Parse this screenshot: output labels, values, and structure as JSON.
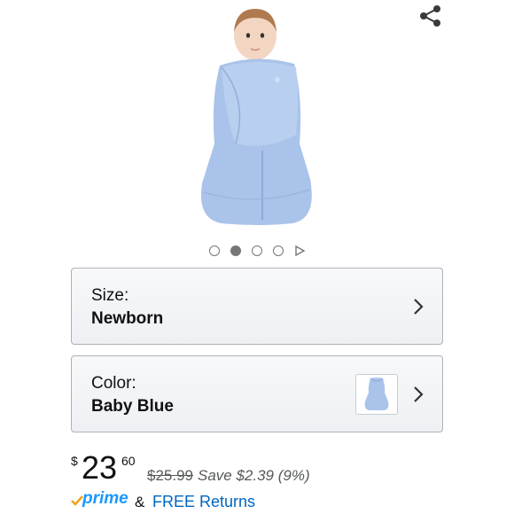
{
  "product": {
    "image_alt": "HALO SleepSack swaddle, baby blue",
    "carousel": {
      "total_dots": 4,
      "active_index": 1
    }
  },
  "size_selector": {
    "label": "Size:",
    "value": "Newborn"
  },
  "color_selector": {
    "label": "Color:",
    "value": "Baby Blue"
  },
  "price": {
    "currency_symbol": "$",
    "whole": "23",
    "fraction": "60",
    "list_price": "$25.99",
    "savings": "Save $2.39 (9%)"
  },
  "prime": {
    "brand": "prime",
    "ampersand": "&",
    "returns_link": "FREE Returns"
  },
  "colors": {
    "accent_blue": "#0066c0",
    "prime_blue": "#1a98ff",
    "prime_check": "#f0a41d",
    "swaddle_blue": "#a9c3ea"
  },
  "icons": [
    "share-icon",
    "chevron-right-icon",
    "play-icon",
    "prime-check-icon"
  ]
}
